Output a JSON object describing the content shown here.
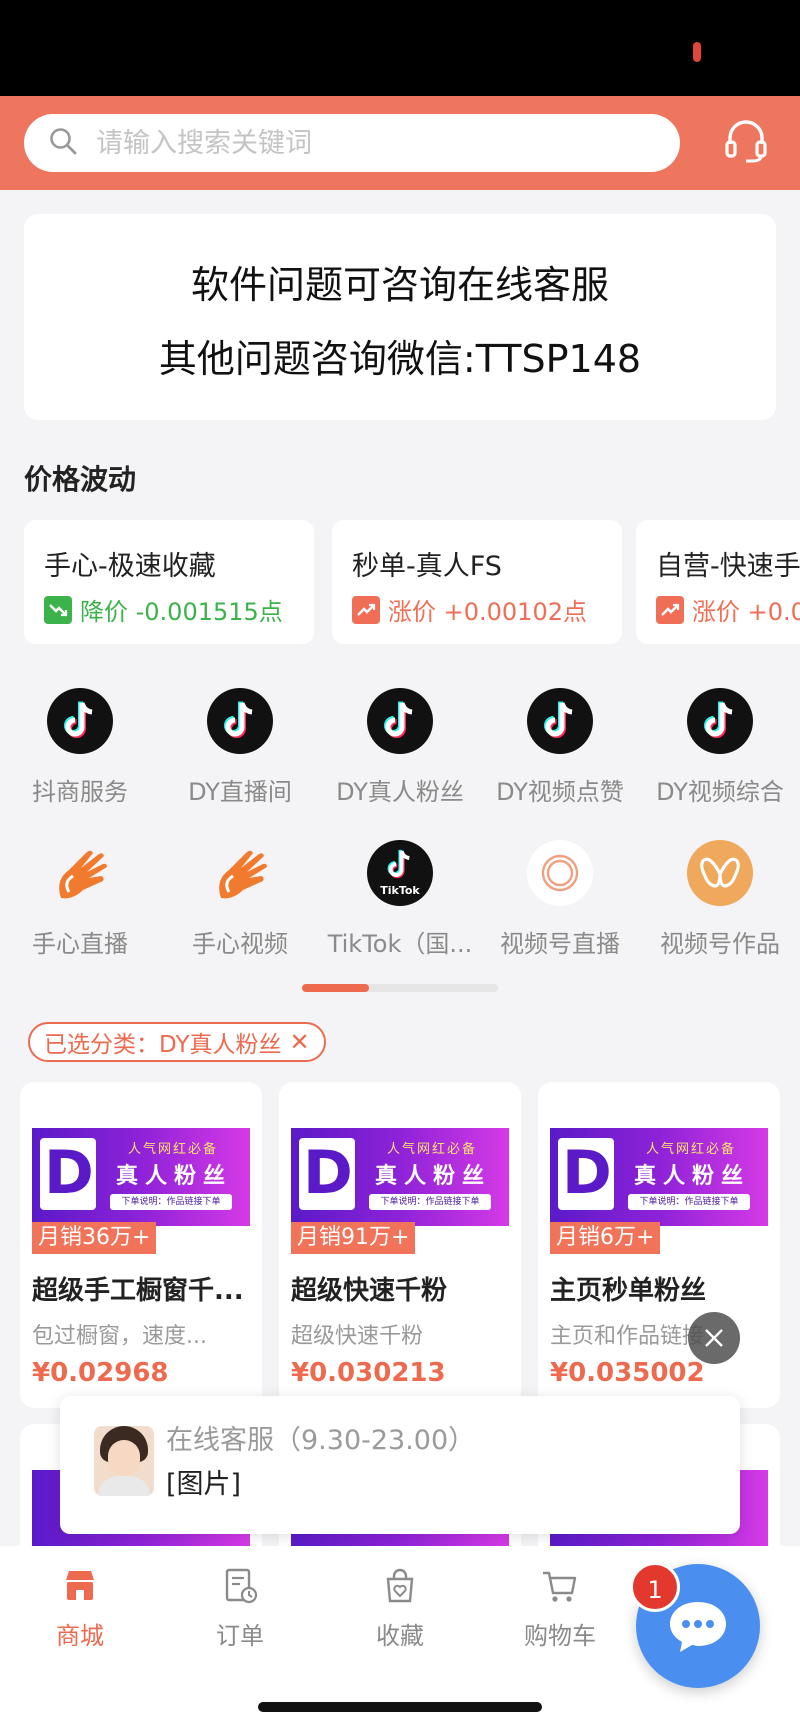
{
  "search": {
    "placeholder": "请输入搜索关键词"
  },
  "notice": {
    "line1": "软件问题可咨询在线客服",
    "line2": "其他问题咨询微信:TTSP148"
  },
  "price_section": {
    "title": "价格波动",
    "cards": [
      {
        "name": "手心-极速收藏",
        "change": "降价 -0.001515点",
        "direction": "down"
      },
      {
        "name": "秒单-真人FS",
        "change": "涨价 +0.00102点",
        "direction": "up"
      },
      {
        "name": "自营-快速手",
        "change": "涨价 +0.0",
        "direction": "up"
      }
    ]
  },
  "categories": [
    {
      "label": "抖商服务",
      "icon": "douyin-icon"
    },
    {
      "label": "DY直播间",
      "icon": "douyin-icon"
    },
    {
      "label": "DY真人粉丝",
      "icon": "douyin-icon"
    },
    {
      "label": "DY视频点赞",
      "icon": "douyin-icon"
    },
    {
      "label": "DY视频综合",
      "icon": "douyin-icon"
    },
    {
      "label": "手心直播",
      "icon": "hand-icon"
    },
    {
      "label": "手心视频",
      "icon": "hand-icon"
    },
    {
      "label": "TikTok（国...",
      "icon": "tiktok-icon"
    },
    {
      "label": "视频号直播",
      "icon": "ring-icon"
    },
    {
      "label": "视频号作品",
      "icon": "butterfly-icon"
    }
  ],
  "tiktok_logo_text": "TikTok",
  "category_scroll": {
    "progress": 0.34
  },
  "filter": {
    "label": "已选分类：DY真人粉丝",
    "close": "✕"
  },
  "banner": {
    "letter": "D",
    "top": "人气网红必备",
    "main": "真人粉丝",
    "note": "下单说明：作品链接下单"
  },
  "products": [
    {
      "sales": "月销36万+",
      "title": "超级手工橱窗千...",
      "desc": "包过橱窗，速度...",
      "price": "¥0.02968"
    },
    {
      "sales": "月销91万+",
      "title": "超级快速千粉",
      "desc": "超级快速千粉",
      "price": "¥0.030213"
    },
    {
      "sales": "月销6万+",
      "title": "主页秒单粉丝",
      "desc": "主页和作品链接",
      "price": "¥0.035002"
    }
  ],
  "chat_popup": {
    "title": "在线客服（9.30-23.00）",
    "message": "[图片]"
  },
  "tabbar": {
    "tabs": [
      {
        "label": "商城",
        "icon": "store-icon",
        "active": true
      },
      {
        "label": "订单",
        "icon": "order-icon",
        "active": false
      },
      {
        "label": "收藏",
        "icon": "favorite-bag-icon",
        "active": false
      },
      {
        "label": "购物车",
        "icon": "cart-icon",
        "active": false
      }
    ]
  },
  "chat_badge": "1",
  "colors": {
    "brand": "#ee765e",
    "accent": "#ee6a4f",
    "down": "#3bb34a",
    "fab": "#4a8ff0"
  }
}
